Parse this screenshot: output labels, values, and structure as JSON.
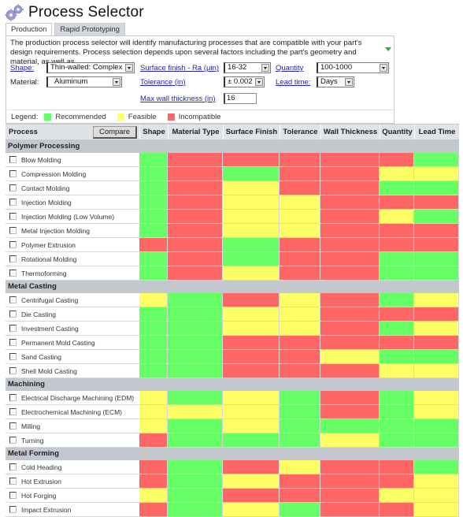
{
  "app": {
    "title": "Process Selector",
    "icon": "gears-icon"
  },
  "tabs": [
    {
      "label": "Production",
      "active": true
    },
    {
      "label": "Rapid Prototyping",
      "active": false
    }
  ],
  "description": "The production process selector will identify manufacturing processes that are compatible with your part's design requirements. Process selection depends upon several factors including the part's geometry and material, as well as",
  "form": {
    "shape": {
      "label": "Shape:",
      "value": "Thin-walled: Complex"
    },
    "material": {
      "label": "Material:",
      "value": "Aluminum"
    },
    "surface_finish": {
      "label": "Surface finish - Ra (μin)",
      "value": "16-32"
    },
    "tolerance": {
      "label": "Tolerance (in)",
      "value": "± 0.002"
    },
    "max_wall": {
      "label": "Max wall thickness (in)",
      "value": "16"
    },
    "quantity": {
      "label": "Quantity",
      "value": "100-1000"
    },
    "lead_time": {
      "label": "Lead time:",
      "value": "Days"
    }
  },
  "legend": {
    "label": "Legend:",
    "items": [
      {
        "label": "Recommended",
        "color": "#66ff66"
      },
      {
        "label": "Feasible",
        "color": "#ffff66"
      },
      {
        "label": "Incompatible",
        "color": "#ff6666"
      }
    ]
  },
  "colors": {
    "G": "#66ff66",
    "Y": "#ffff66",
    "R": "#ff6666"
  },
  "table": {
    "process_header": "Process",
    "compare_label": "Compare",
    "columns": [
      "Shape",
      "Material Type",
      "Surface Finish",
      "Tolerance",
      "Wall Thickness",
      "Quantity",
      "Lead Time"
    ],
    "groups": [
      {
        "name": "Polymer Processing",
        "processes": [
          {
            "name": "Blow Molding",
            "ratings": [
              "G",
              "R",
              "R",
              "R",
              "R",
              "R",
              "G"
            ]
          },
          {
            "name": "Compression  Molding",
            "ratings": [
              "G",
              "R",
              "G",
              "R",
              "R",
              "Y",
              "Y"
            ]
          },
          {
            "name": "Contact Molding",
            "ratings": [
              "G",
              "R",
              "Y",
              "R",
              "R",
              "G",
              "G"
            ]
          },
          {
            "name": "Injection Molding",
            "ratings": [
              "G",
              "R",
              "Y",
              "Y",
              "R",
              "R",
              "R"
            ]
          },
          {
            "name": "Injection Molding (Low Volume)",
            "ratings": [
              "G",
              "R",
              "Y",
              "Y",
              "R",
              "Y",
              "G"
            ]
          },
          {
            "name": "Metal Injection Molding",
            "ratings": [
              "G",
              "R",
              "Y",
              "Y",
              "R",
              "R",
              "R"
            ]
          },
          {
            "name": "Polymer Extrusion",
            "ratings": [
              "R",
              "R",
              "G",
              "R",
              "R",
              "R",
              "R"
            ]
          },
          {
            "name": "Rotational Molding",
            "ratings": [
              "G",
              "R",
              "G",
              "R",
              "R",
              "G",
              "G"
            ]
          },
          {
            "name": "Thermoforming",
            "ratings": [
              "G",
              "R",
              "Y",
              "R",
              "R",
              "G",
              "G"
            ]
          }
        ]
      },
      {
        "name": "Metal Casting",
        "processes": [
          {
            "name": "Centrifugal Casting",
            "ratings": [
              "Y",
              "G",
              "R",
              "Y",
              "R",
              "G",
              "Y"
            ]
          },
          {
            "name": "Die Casting",
            "ratings": [
              "G",
              "G",
              "Y",
              "Y",
              "R",
              "R",
              "R"
            ]
          },
          {
            "name": "Investment Casting",
            "ratings": [
              "G",
              "G",
              "Y",
              "Y",
              "R",
              "G",
              "Y"
            ]
          },
          {
            "name": "Permanent Mold Casting",
            "ratings": [
              "G",
              "G",
              "R",
              "R",
              "R",
              "R",
              "R"
            ]
          },
          {
            "name": "Sand Casting",
            "ratings": [
              "G",
              "G",
              "R",
              "R",
              "Y",
              "G",
              "G"
            ]
          },
          {
            "name": "Shell Mold Casting",
            "ratings": [
              "G",
              "G",
              "R",
              "R",
              "R",
              "Y",
              "Y"
            ]
          }
        ]
      },
      {
        "name": "Machining",
        "processes": [
          {
            "name": "Electrical Discharge Machining (EDM)",
            "ratings": [
              "Y",
              "G",
              "Y",
              "G",
              "R",
              "G",
              "Y"
            ]
          },
          {
            "name": "Electrochemical Machining (ECM)",
            "ratings": [
              "Y",
              "Y",
              "Y",
              "G",
              "R",
              "G",
              "Y"
            ]
          },
          {
            "name": "Milling",
            "ratings": [
              "Y",
              "G",
              "Y",
              "G",
              "G",
              "G",
              "G"
            ]
          },
          {
            "name": "Turning",
            "ratings": [
              "R",
              "G",
              "G",
              "G",
              "Y",
              "G",
              "G"
            ]
          }
        ]
      },
      {
        "name": "Metal Forming",
        "processes": [
          {
            "name": "Cold Heading",
            "ratings": [
              "R",
              "G",
              "R",
              "Y",
              "R",
              "R",
              "G"
            ]
          },
          {
            "name": "Hot Extrusion",
            "ratings": [
              "R",
              "G",
              "Y",
              "R",
              "R",
              "R",
              "Y"
            ]
          },
          {
            "name": "Hot Forging",
            "ratings": [
              "Y",
              "G",
              "R",
              "R",
              "R",
              "Y",
              "Y"
            ]
          },
          {
            "name": "Impact Extrusion",
            "ratings": [
              "R",
              "G",
              "Y",
              "G",
              "R",
              "R",
              "Y"
            ]
          }
        ]
      }
    ]
  }
}
